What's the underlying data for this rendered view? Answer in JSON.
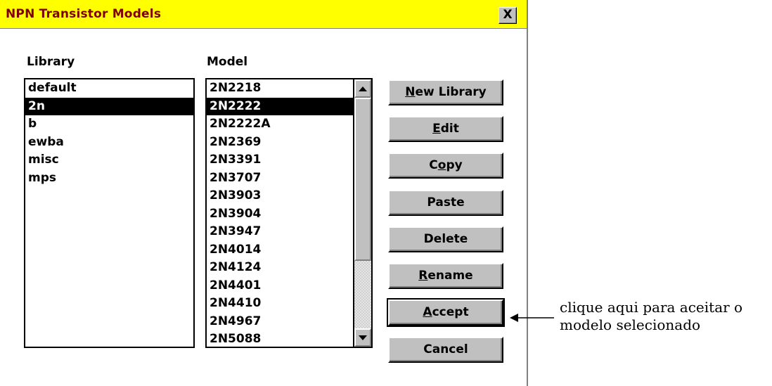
{
  "window": {
    "title": "NPN Transistor Models",
    "close_label": "X"
  },
  "library": {
    "heading": "Library",
    "items": [
      "default",
      "2n",
      "b",
      "ewba",
      "misc",
      "mps"
    ],
    "selected": "2n"
  },
  "model": {
    "heading": "Model",
    "items": [
      "2N2218",
      "2N2222",
      "2N2222A",
      "2N2369",
      "2N3391",
      "2N3707",
      "2N3903",
      "2N3904",
      "2N3947",
      "2N4014",
      "2N4124",
      "2N4401",
      "2N4410",
      "2N4967",
      "2N5088"
    ],
    "selected": "2N2222"
  },
  "buttons": {
    "new_library": {
      "mnemonic": "N",
      "rest": "ew Library"
    },
    "edit": {
      "mnemonic": "E",
      "rest": "dit"
    },
    "copy_pre": "C",
    "copy_mnemonic": "o",
    "copy_rest": "py",
    "paste": "Paste",
    "delete": "Delete",
    "rename": {
      "mnemonic": "R",
      "rest": "ename"
    },
    "accept": {
      "mnemonic": "A",
      "rest": "ccept"
    },
    "cancel": "Cancel"
  },
  "annotation": {
    "line1": "clique aqui para aceitar o",
    "line2": "modelo selecionado"
  },
  "icons": {
    "close": "close-icon",
    "scroll_up": "scroll-up-arrow-icon",
    "scroll_down": "scroll-down-arrow-icon",
    "pointer": "left-arrow-icon"
  }
}
